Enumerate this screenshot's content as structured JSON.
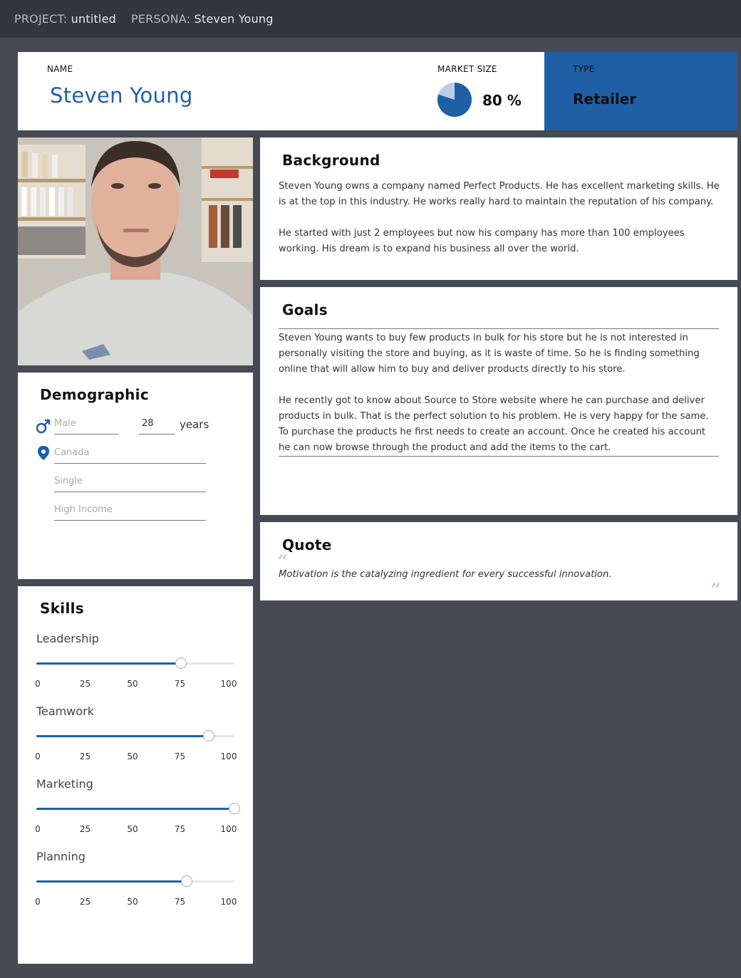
{
  "topbar": {
    "project_label": "PROJECT:",
    "project_value": "untitled",
    "persona_label": "PERSONA:",
    "persona_value": "Steven Young"
  },
  "header": {
    "name_label": "NAME",
    "name_value": "Steven Young",
    "market_label": "MARKET SIZE",
    "market_value": "80 %",
    "market_percent": 80,
    "type_label": "TYPE",
    "type_value": "Retailer"
  },
  "background": {
    "title": "Background",
    "p1": "Steven Young owns a company named Perfect Products. He has excellent marketing skills. He is at the top in this industry. He works really hard to maintain the reputation of his company.",
    "p2": "He started with just 2 employees but now his company has more than 100 employees working. His dream is to expand his business all over the world."
  },
  "goals": {
    "title": "Goals",
    "p1": "Steven Young wants to buy few products in bulk for his store but he is not interested in personally visiting the store and buying, as it is waste of time. So he is finding something online that will allow him to buy and deliver products directly to his store.",
    "p2": "He recently got to know about Source to Store website where he can purchase and deliver products in bulk. That is the perfect solution to his problem. He is very happy for the same.",
    "p3": "To purchase the products he first needs to create an account. Once he created his account he can now browse through the product and add the items to the cart."
  },
  "quote": {
    "title": "Quote",
    "text": "Motivation is the catalyzing ingredient for every successful innovation."
  },
  "demographic": {
    "title": "Demographic",
    "gender": "Male",
    "age": "28",
    "age_unit": "years",
    "location": "Canada",
    "status": "Single",
    "income": "High Income"
  },
  "skills": {
    "title": "Skills",
    "tick_labels": [
      "0",
      "25",
      "50",
      "75",
      "100"
    ],
    "items": [
      {
        "label": "Leadership",
        "value": 73
      },
      {
        "label": "Teamwork",
        "value": 87
      },
      {
        "label": "Marketing",
        "value": 100
      },
      {
        "label": "Planning",
        "value": 76
      }
    ]
  },
  "colors": {
    "accent": "#1f5fa6",
    "background": "#464a53",
    "topbar": "#33363c"
  }
}
